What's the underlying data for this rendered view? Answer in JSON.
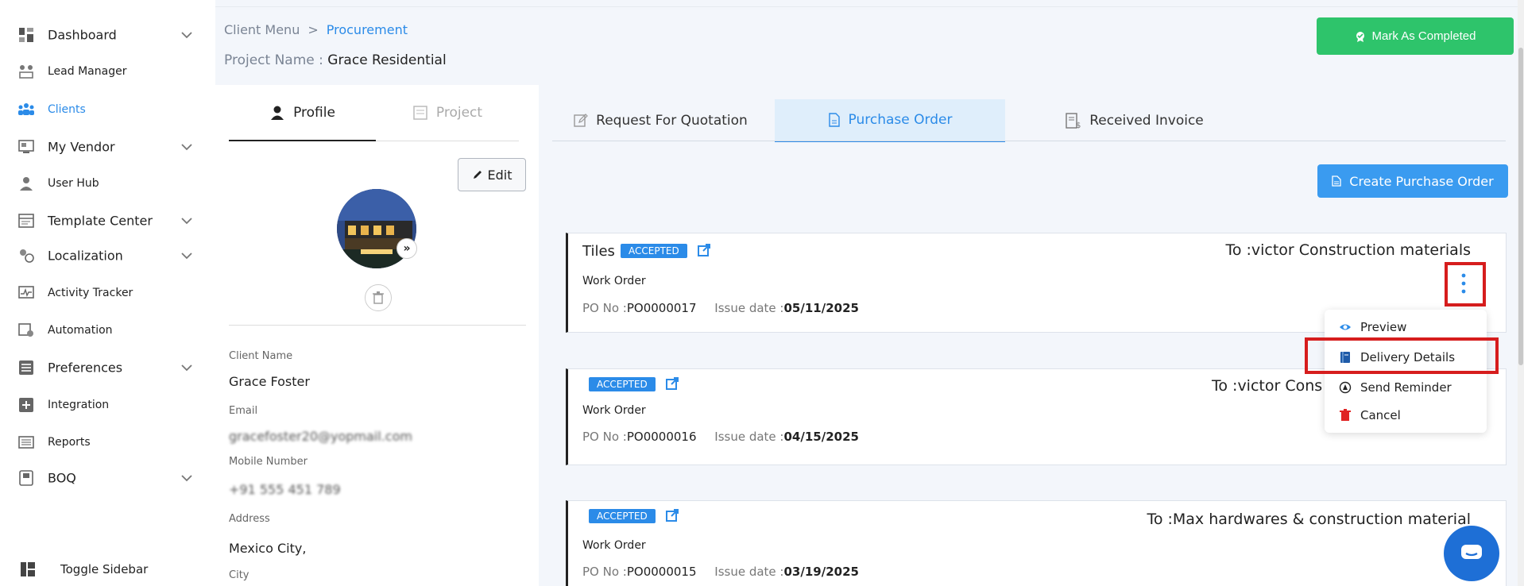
{
  "sidebar": {
    "items": [
      {
        "label": "Dashboard",
        "icon": "dashboard-icon",
        "expandable": true
      },
      {
        "label": "Lead Manager",
        "icon": "lead-manager-icon",
        "expandable": false
      },
      {
        "label": "Clients",
        "icon": "clients-icon",
        "expandable": false,
        "active": true
      },
      {
        "label": "My Vendor",
        "icon": "vendor-icon",
        "expandable": true
      },
      {
        "label": "User Hub",
        "icon": "user-icon",
        "expandable": false
      },
      {
        "label": "Template Center",
        "icon": "template-icon",
        "expandable": true
      },
      {
        "label": "Localization",
        "icon": "localization-icon",
        "expandable": true
      },
      {
        "label": "Activity Tracker",
        "icon": "activity-icon",
        "expandable": false
      },
      {
        "label": "Automation",
        "icon": "automation-icon",
        "expandable": false
      },
      {
        "label": "Preferences",
        "icon": "preferences-icon",
        "expandable": true
      },
      {
        "label": "Integration",
        "icon": "integration-icon",
        "expandable": false
      },
      {
        "label": "Reports",
        "icon": "reports-icon",
        "expandable": false
      },
      {
        "label": "BOQ",
        "icon": "boq-icon",
        "expandable": true
      }
    ],
    "toggle_label": "Toggle Sidebar",
    "accent_color": "#2b8be8"
  },
  "breadcrumb": {
    "parent": "Client Menu",
    "separator": ">",
    "current": "Procurement"
  },
  "project": {
    "label": "Project Name :",
    "name": "Grace Residential"
  },
  "header": {
    "complete_button": "Mark As Completed",
    "complete_color": "#2ec46b"
  },
  "profile": {
    "tabs": {
      "profile": "Profile",
      "project": "Project"
    },
    "edit_label": "Edit",
    "fields": [
      {
        "label": "Client Name",
        "value": "Grace Foster"
      },
      {
        "label": "Email",
        "value": "gracefoster20@yopmail.com"
      },
      {
        "label": "Mobile Number",
        "value": "+91 555 451 789"
      },
      {
        "label": "Address",
        "value": "Mexico City,"
      },
      {
        "label": "City",
        "value": ""
      }
    ]
  },
  "po": {
    "tabs": [
      "Request For Quotation",
      "Purchase Order",
      "Received Invoice"
    ],
    "active_tab": "Purchase Order",
    "create_button": "Create Purchase Order",
    "no_label": "PO No :",
    "date_label": "Issue date :",
    "orders": [
      {
        "title": "Tiles",
        "status": "ACCEPTED",
        "to": "To :victor Construction materials",
        "type": "Work Order",
        "po_no": "PO0000017",
        "issue_date": "05/11/2025"
      },
      {
        "title": "",
        "status": "ACCEPTED",
        "to": "To :victor Cons",
        "type": "Work Order",
        "po_no": "PO0000016",
        "issue_date": "04/15/2025"
      },
      {
        "title": "",
        "status": "ACCEPTED",
        "to": "To :Max hardwares & construction material",
        "type": "Work Order",
        "po_no": "PO0000015",
        "issue_date": "03/19/2025"
      }
    ]
  },
  "context_menu": {
    "items": [
      {
        "label": "Preview",
        "icon": "eye-icon"
      },
      {
        "label": "Delivery Details",
        "icon": "notebook-icon"
      },
      {
        "label": "Send Reminder",
        "icon": "reminder-icon"
      },
      {
        "label": "Cancel",
        "icon": "trash-icon",
        "color": "#e02424"
      }
    ]
  },
  "chat": {
    "icon": "chat-icon"
  }
}
